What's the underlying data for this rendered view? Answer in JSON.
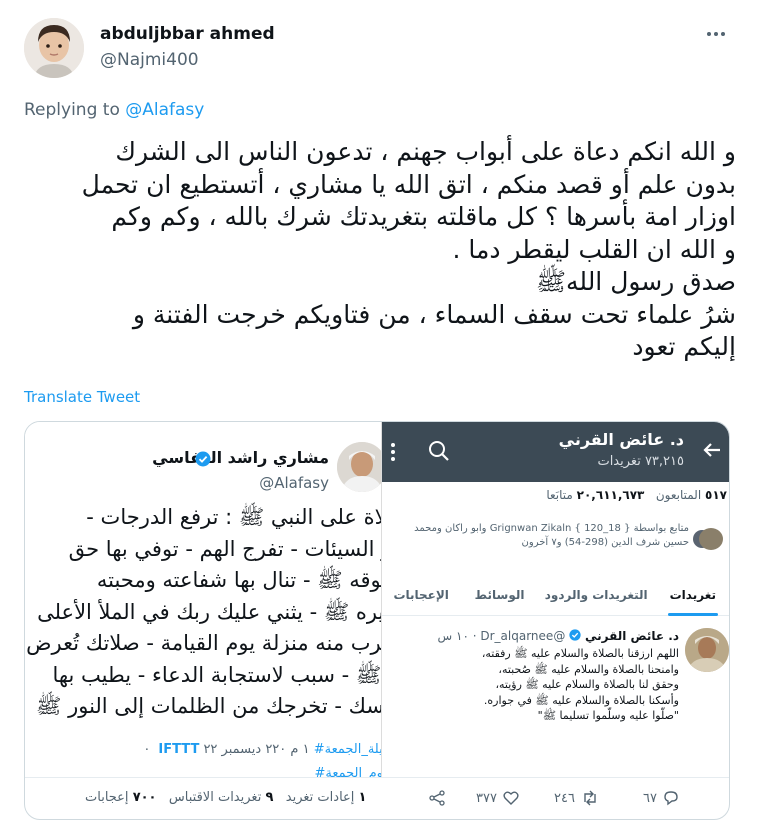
{
  "user": {
    "name": "abduljbbar ahmed",
    "handle": "@Najmi400"
  },
  "replying": {
    "prefix": "Replying to ",
    "mention": "@Alafasy"
  },
  "tweet": {
    "lines": [
      "و الله انكم دعاة على أبواب جهنم ، تدعون الناس الى الشرك",
      "بدون علم أو قصد منكم ، اتق الله يا مشاري ، أتستطيع ان تحمل",
      "اوزار امة بأسرها ؟ كل ماقلته بتغريدتك شرك بالله ، وكم وكم",
      "و الله ان القلب ليقطر دما .",
      "صدق رسول اللهﷺ",
      "شرُ علماء تحت سقف السماء ، من فتاويكم خرجت الفتنة و",
      "إليكم تعود"
    ],
    "translate_label": "Translate Tweet"
  },
  "embedded_left": {
    "name": "مشاري راشد العفاسي",
    "handle": "@Alafasy",
    "body_lines": [
      "صلاة على النبي ﷺ : ترفع الدرجات -",
      "حو السيئات - تفرج الهم - توفي بها حق",
      "حقوقه ﷺ - تنال بها شفاعته ومحبته",
      "وقيره ﷺ - يثني عليك ربك في الملأ الأعلى",
      "القرب منه منزلة يوم القيامة - صلاتك تُعرض",
      "يه ﷺ - سبب لاستجابة الدعاء - يطيب بها",
      "جلسك - تخرجك من الظلمات إلى النور ﷺ"
    ],
    "hashtag1": "ليلة_الجمعة#",
    "date": " ١ م ٢٢٠ ديسمبر ٢٢ ٠",
    "source": "IFTTT",
    "hashtag2": "يوم_الجمعة#"
  },
  "embedded_right": {
    "title": "د. عائض القرني",
    "subtitle": "٧٣,٢١٥ تغريدات",
    "followers_count": "٥١٧",
    "followers_label": "المتابعون",
    "following_count": "٢٠,٦١١,٦٧٣",
    "following_label": "متابَعا",
    "followed_by": "متابع بواسطة { 18_120 } Grignwan Zikaln وابو راكان ومحمد حسين شرف الدين (298-54) و٧ آخرون",
    "tabs": [
      "تغريدات",
      "التغريدات والردود",
      "الوسائط",
      "الإعجابات"
    ],
    "tweet_author": "د. عائض القرني",
    "tweet_handle": "@Dr_alqarnee",
    "tweet_time": "· ١٠ س",
    "tweet_lines": [
      "اللهم ارزقنا بالصلاة والسلام عليه ﷺ رفقته،",
      "وامنحنا بالصلاة والسلام عليه ﷺ صُحبته،",
      "وحقق لنا بالصلاة والسلام عليه ﷺ رؤيته،",
      "وأسكنا بالصلاة والسلام عليه ﷺ في جواره.",
      "\"صلّوا عليه وسلّموا تسليما ﷺ\""
    ],
    "replies": "٦٧",
    "retweets": "٢٤٦",
    "likes": "٣٧٧"
  },
  "stats": {
    "retweets_count": "١",
    "retweets_label": "إعادات تغريد",
    "quotes_count": "٩",
    "quotes_label": "تغريدات الاقتباس",
    "likes_count": "٧٠٠",
    "likes_label": "إعجابات"
  },
  "colors": {
    "accent": "#1d9bf0",
    "secondary_text": "#536471",
    "header_bar": "#3c4a55"
  }
}
